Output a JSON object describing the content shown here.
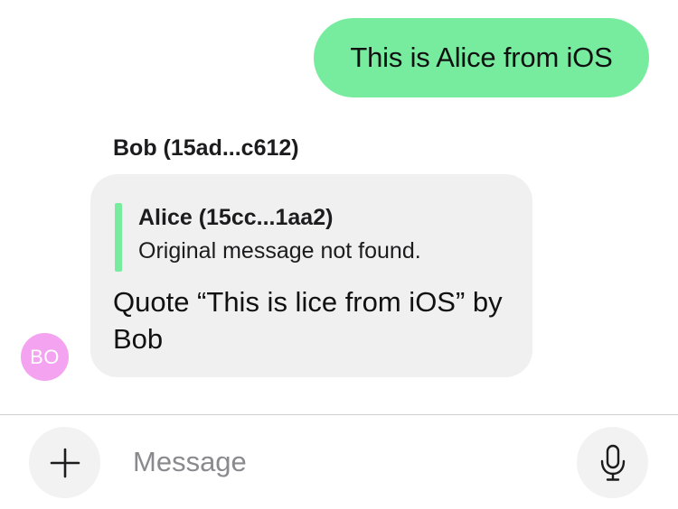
{
  "conversation": {
    "outgoing_message": {
      "text": "This is Alice from iOS",
      "bubble_color": "#77ec9f"
    },
    "incoming_message": {
      "sender": "Bob (15ad...c612)",
      "quote": {
        "author": "Alice (15cc...1aa2)",
        "text": "Original message not found.",
        "bar_color": "#77ec9f"
      },
      "body": "Quote “This is lice from iOS” by Bob",
      "bubble_color": "#f0f0f0"
    },
    "avatar": {
      "initials": "BO",
      "color": "#f3a3ef"
    }
  },
  "composer": {
    "attach_icon": "plus-icon",
    "placeholder": "Message",
    "value": "",
    "mic_icon": "microphone-icon"
  }
}
